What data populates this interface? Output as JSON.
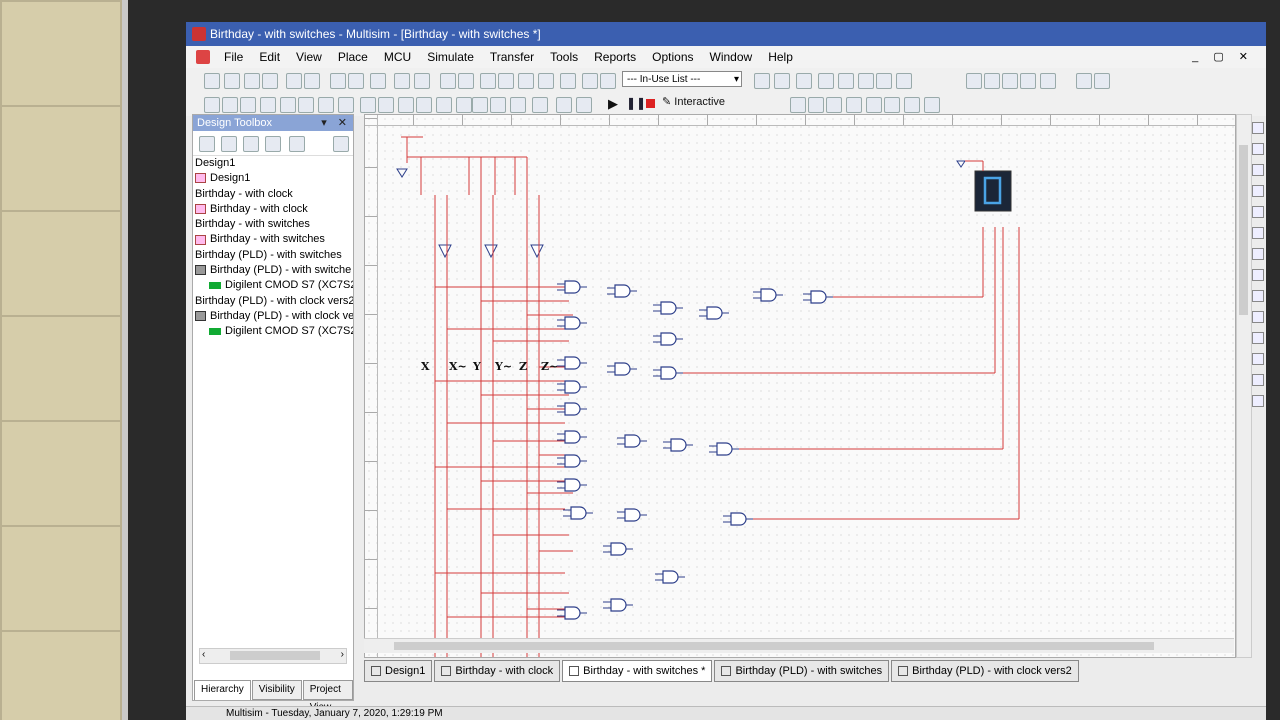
{
  "window": {
    "title": "Birthday - with switches - Multisim - [Birthday - with switches *]"
  },
  "menu": {
    "items": [
      "File",
      "Edit",
      "View",
      "Place",
      "MCU",
      "Simulate",
      "Transfer",
      "Tools",
      "Reports",
      "Options",
      "Window",
      "Help"
    ]
  },
  "toolbar": {
    "in_use_list": "--- In-Use List ---",
    "interactive_label": "Interactive"
  },
  "toolbox": {
    "title": "Design Toolbox",
    "tree": [
      {
        "label": "Design1",
        "icon": "none",
        "indent": 0
      },
      {
        "label": "Design1",
        "icon": "schematic",
        "indent": 1
      },
      {
        "label": "Birthday - with clock",
        "icon": "none",
        "indent": 0
      },
      {
        "label": "Birthday - with clock",
        "icon": "schematic",
        "indent": 1
      },
      {
        "label": "Birthday - with switches",
        "icon": "none",
        "indent": 0
      },
      {
        "label": "Birthday - with switches",
        "icon": "schematic",
        "indent": 1
      },
      {
        "label": "Birthday (PLD) - with switches",
        "icon": "none",
        "indent": 0
      },
      {
        "label": "Birthday (PLD) - with switche",
        "icon": "pld",
        "indent": 1
      },
      {
        "label": "Digilent CMOD S7 (XC7S2",
        "icon": "chip",
        "indent": 2
      },
      {
        "label": "Birthday (PLD) - with clock vers2",
        "icon": "none",
        "indent": 0
      },
      {
        "label": "Birthday (PLD) - with clock ve",
        "icon": "pld",
        "indent": 1
      },
      {
        "label": "Digilent CMOD S7 (XC7S2",
        "icon": "chip",
        "indent": 2
      }
    ],
    "tabs": [
      "Hierarchy",
      "Visibility",
      "Project View"
    ]
  },
  "schematic": {
    "labels": [
      "X",
      "X~",
      "Y",
      "Y~",
      "Z",
      "Z~"
    ],
    "seven_segment_digit": "0",
    "colors": {
      "wire": "#d43a3a",
      "gate": "#2d3f8a",
      "display_bg": "#1b2638",
      "display_seg": "#4aa3e6"
    }
  },
  "doc_tabs": [
    {
      "label": "Design1",
      "active": false
    },
    {
      "label": "Birthday - with clock",
      "active": false
    },
    {
      "label": "Birthday - with switches *",
      "active": true
    },
    {
      "label": "Birthday (PLD) - with switches",
      "active": false
    },
    {
      "label": "Birthday (PLD) - with clock vers2",
      "active": false
    }
  ],
  "status": {
    "text": "Multisim  -  Tuesday, January 7, 2020, 1:29:19 PM"
  }
}
